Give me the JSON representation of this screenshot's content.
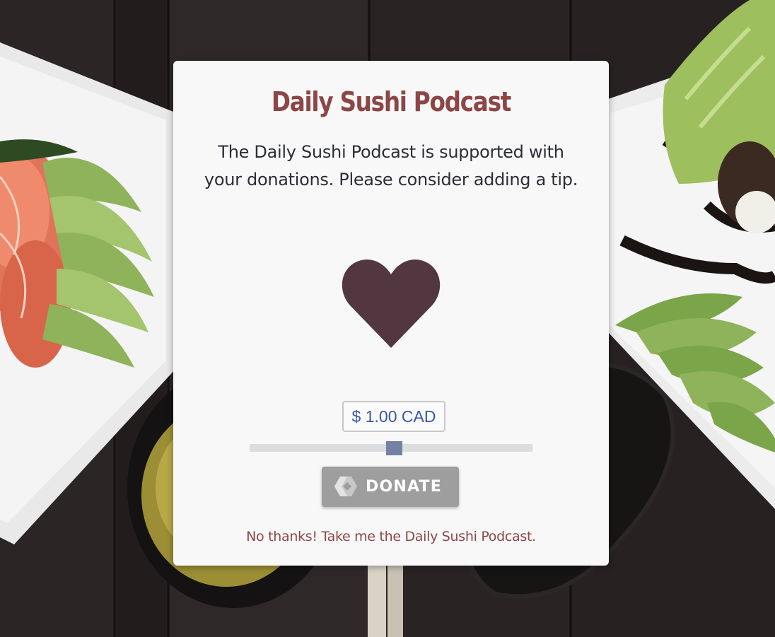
{
  "card": {
    "title": "Daily Sushi Podcast",
    "description": "The Daily Sushi Podcast is supported with your donations. Please consider adding a tip.",
    "heart_color": "#533740",
    "title_color": "#8c4646"
  },
  "donation": {
    "amount_display": "$ 1.00 CAD",
    "slider_value": 1.0,
    "slider_position_fraction": 0.51,
    "donate_label": "DONATE",
    "donate_icon": "kofi-diamond-icon"
  },
  "footer": {
    "no_thanks_label": "No thanks! Take me the Daily Sushi Podcast."
  },
  "background": {
    "description_icon": "sushi-platter-photo"
  }
}
